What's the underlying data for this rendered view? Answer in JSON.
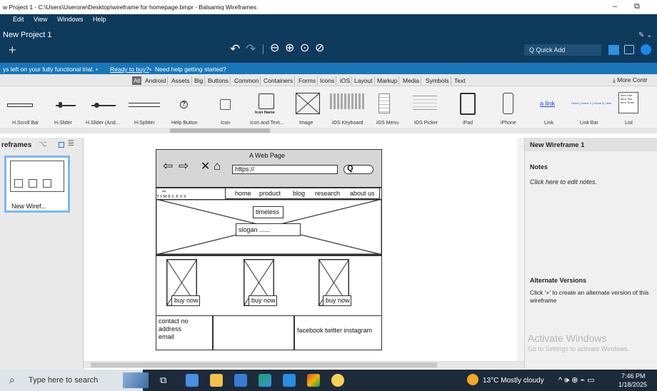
{
  "window": {
    "title": "w Project 1 - C:\\Users\\Userone\\Desktop\\wireframe for homepage.bmpr - Balsamiq Wireframes",
    "minimize": "–",
    "restore": "⧉"
  },
  "menu": [
    "Edit",
    "View",
    "Windows",
    "Help"
  ],
  "project": {
    "name": "New Project 1",
    "add": "+",
    "pen": "✎ ⌄"
  },
  "toolbar": {
    "undo": "↶",
    "redo": "↷",
    "zoom_out": "⊖",
    "zoom_in": "⊕",
    "zoom_fit": "⊙",
    "zoom_reset": "⊘",
    "quick_add_placeholder": "Q Quick Add"
  },
  "trial": {
    "prefix": "ys left on your fully functional trial.  •",
    "buy": "Ready to buy?",
    "sep": "•",
    "help": "Need help getting started?"
  },
  "filters": [
    "All",
    "Android",
    "Assets",
    "Big",
    "Buttons",
    "Common",
    "Containers",
    "Forms",
    "Icons",
    "iOS",
    "Layout",
    "Markup",
    "Media",
    "Symbols",
    "Text"
  ],
  "more_controls": "⤓ More Contr",
  "library": [
    {
      "label": "H.Scroll Bar"
    },
    {
      "label": "H.Slider"
    },
    {
      "label": "H.Slider (And..."
    },
    {
      "label": "H.Splitter"
    },
    {
      "label": "Help Button"
    },
    {
      "label": "Icon"
    },
    {
      "label": "Icon and Text..."
    },
    {
      "label": "Image"
    },
    {
      "label": "iOS Keyboard"
    },
    {
      "label": "iOS Menu"
    },
    {
      "label": "iOS Picker"
    },
    {
      "label": "iPad"
    },
    {
      "label": "iPhone"
    },
    {
      "label": "Link"
    },
    {
      "label": "Link Bar"
    },
    {
      "label": "List"
    }
  ],
  "library_previews": {
    "icon_name": "Icon Name",
    "link": "a link",
    "linkbar": "Home | Home 2 | Home 3 | Item",
    "list": [
      "Item One",
      "Item Two",
      "Item Three"
    ]
  },
  "left_panel": {
    "header": "reframes",
    "thumb_label": "New Wiref..."
  },
  "wireframe": {
    "title": "A Web Page",
    "url": "https://",
    "logo": "TIMELESS",
    "nav": [
      "home",
      "product",
      "blog",
      "research",
      "about us"
    ],
    "hero_title": "timeless",
    "slogan": "slogan ......",
    "buy": [
      "buy now",
      "buy now",
      "buy now"
    ],
    "footer_left": [
      "contact no",
      "address",
      "email"
    ],
    "footer_right": "facebook twitter instagram"
  },
  "right_panel": {
    "title": "New Wireframe 1",
    "notes_header": "Notes",
    "notes_placeholder": "Click here to edit notes.",
    "alt_header": "Alternate Versions",
    "alt_text": "Click '+' to create an alternate version of this wireframe",
    "activate_title": "Activate Windows",
    "activate_sub": "Go to Settings to activate Windows."
  },
  "taskbar": {
    "search": "Type here to search",
    "weather": "13°C  Mostly cloudy",
    "tray": "^ 🕪 ⊕ ⌁ ▭",
    "time": "7:46 PM",
    "date": "1/18/2025"
  },
  "colors": {
    "app_bar": "#0e3a5c",
    "trial_bar": "#1976b8",
    "taskbar": "#1c2a3a",
    "selected_filter": "#6b6b6b"
  }
}
